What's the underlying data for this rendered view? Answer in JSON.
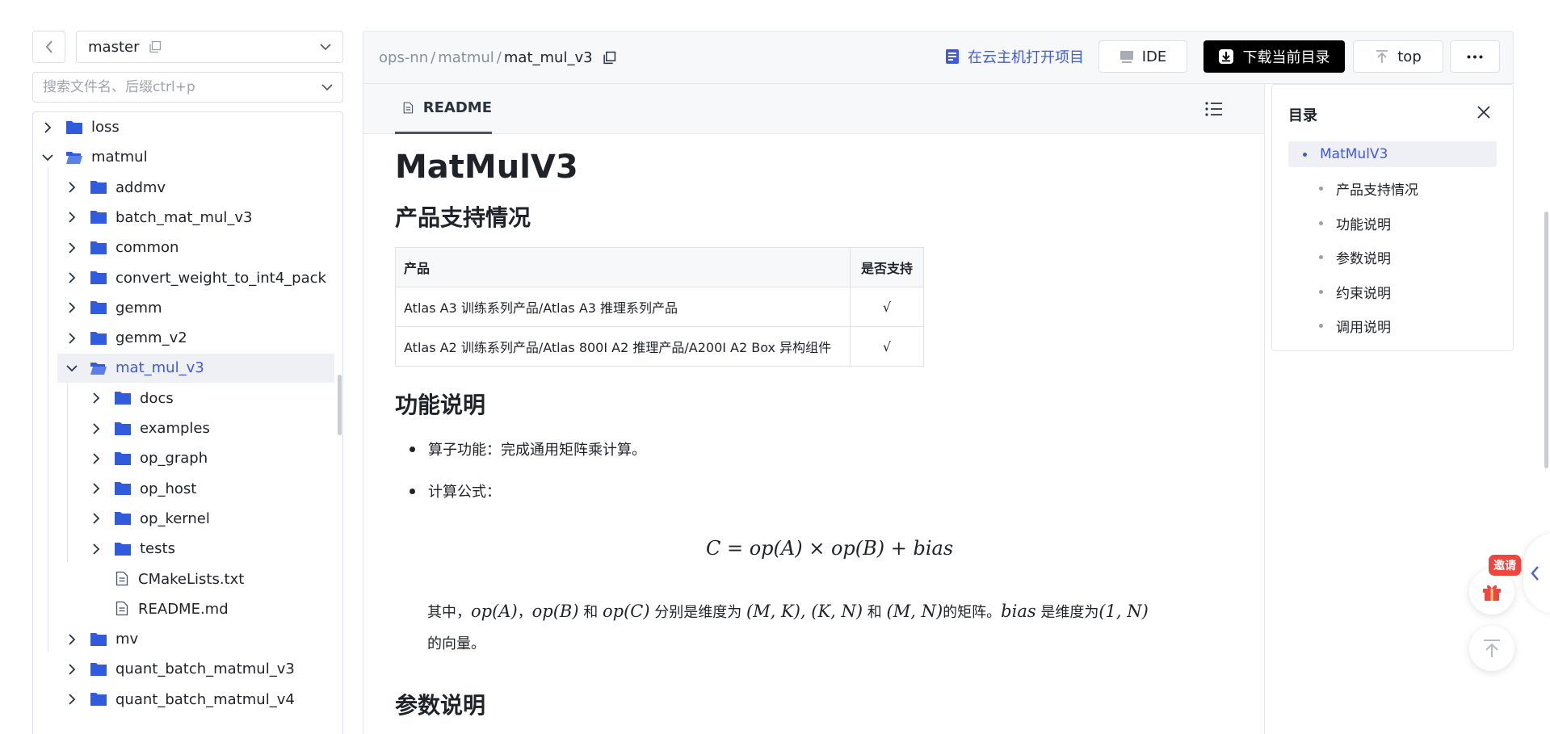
{
  "branch": {
    "name": "master"
  },
  "search": {
    "placeholder": "搜索文件名、后缀ctrl+p"
  },
  "tree": [
    {
      "label": "loss",
      "type": "folder",
      "expanded": false,
      "depth": 0
    },
    {
      "label": "matmul",
      "type": "folder",
      "expanded": true,
      "depth": 0
    },
    {
      "label": "addmv",
      "type": "folder",
      "expanded": false,
      "depth": 1
    },
    {
      "label": "batch_mat_mul_v3",
      "type": "folder",
      "expanded": false,
      "depth": 1
    },
    {
      "label": "common",
      "type": "folder",
      "expanded": false,
      "depth": 1
    },
    {
      "label": "convert_weight_to_int4_pack",
      "type": "folder",
      "expanded": false,
      "depth": 1
    },
    {
      "label": "gemm",
      "type": "folder",
      "expanded": false,
      "depth": 1
    },
    {
      "label": "gemm_v2",
      "type": "folder",
      "expanded": false,
      "depth": 1
    },
    {
      "label": "mat_mul_v3",
      "type": "folder",
      "expanded": true,
      "depth": 1,
      "selected": true
    },
    {
      "label": "docs",
      "type": "folder",
      "expanded": false,
      "depth": 2
    },
    {
      "label": "examples",
      "type": "folder",
      "expanded": false,
      "depth": 2
    },
    {
      "label": "op_graph",
      "type": "folder",
      "expanded": false,
      "depth": 2
    },
    {
      "label": "op_host",
      "type": "folder",
      "expanded": false,
      "depth": 2
    },
    {
      "label": "op_kernel",
      "type": "folder",
      "expanded": false,
      "depth": 2
    },
    {
      "label": "tests",
      "type": "folder",
      "expanded": false,
      "depth": 2
    },
    {
      "label": "CMakeLists.txt",
      "type": "file",
      "depth": 2
    },
    {
      "label": "README.md",
      "type": "file",
      "depth": 2
    },
    {
      "label": "mv",
      "type": "folder",
      "expanded": false,
      "depth": 1
    },
    {
      "label": "quant_batch_matmul_v3",
      "type": "folder",
      "expanded": false,
      "depth": 1
    },
    {
      "label": "quant_batch_matmul_v4",
      "type": "folder",
      "expanded": false,
      "depth": 1
    }
  ],
  "breadcrumb": {
    "root": "ops-nn",
    "parent": "matmul",
    "current": "mat_mul_v3",
    "sep": "/"
  },
  "toolbar": {
    "cloud": "在云主机打开项目",
    "ide": "IDE",
    "download": "下载当前目录",
    "top": "top"
  },
  "readme": {
    "tab": "README",
    "title": "MatMulV3",
    "h_support": "产品支持情况",
    "table": {
      "headers": [
        "产品",
        "是否支持"
      ],
      "rows": [
        [
          "Atlas A3 训练系列产品/Atlas A3 推理系列产品",
          "√"
        ],
        [
          "Atlas A2 训练系列产品/Atlas 800I A2 推理产品/A200I A2 Box 异构组件",
          "√"
        ]
      ]
    },
    "h_func": "功能说明",
    "bullet1": "算子功能：完成通用矩阵乘计算。",
    "bullet2": "计算公式：",
    "formula": "C = op(A) × op(B) + bias",
    "desc": {
      "p1": "其中，",
      "m1": "op(A)",
      "p2": "，",
      "m2": "op(B)",
      "p3": " 和 ",
      "m3": "op(C)",
      "p4": " 分别是维度为 ",
      "m4": "(M, K), (K, N)",
      "p5": " 和 ",
      "m5": "(M, N)",
      "p6": "的矩阵。",
      "m6": "bias",
      "p7": " 是维度为",
      "m7": "(1, N)",
      "line2": "的向量。"
    },
    "h_params": "参数说明"
  },
  "toc": {
    "title": "目录",
    "items": [
      "MatMulV3",
      "产品支持情况",
      "功能说明",
      "参数说明",
      "约束说明",
      "调用说明"
    ],
    "active_index": 0
  },
  "floating": {
    "invite": "邀请"
  },
  "colors": {
    "accent": "#3f5ae0",
    "folder": "#2f5bdc",
    "badge": "#f0463f",
    "dark_button": "#000000"
  }
}
